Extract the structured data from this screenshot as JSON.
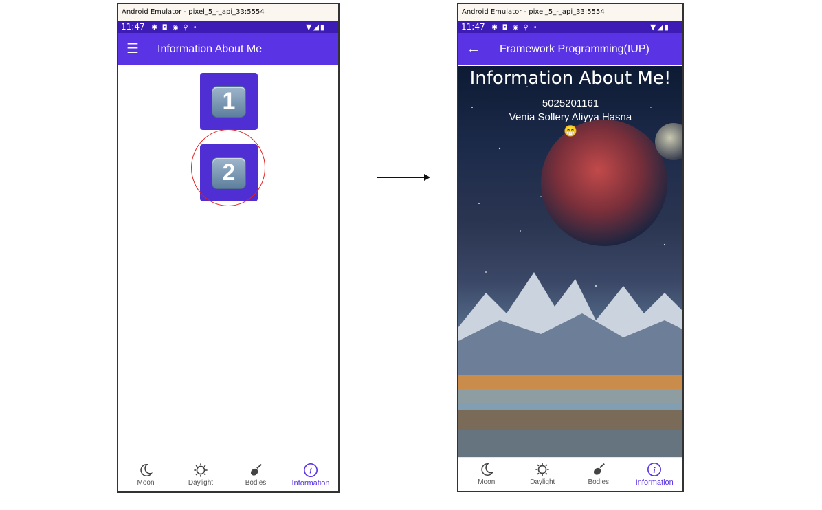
{
  "left_window": {
    "title": "Android Emulator - pixel_5_-_api_33:5554",
    "status_time": "11:47",
    "appbar_title": "Information About Me",
    "buttons": [
      "1",
      "2"
    ]
  },
  "right_window": {
    "title": "Android Emulator - pixel_5_-_api_33:5554",
    "status_time": "11:47",
    "appbar_title": "Framework Programming(IUP)",
    "heading": "Information About Me!",
    "student_id": "5025201161",
    "student_name": "Venia Sollery Aliyya Hasna",
    "emoji": "😁"
  },
  "bottom_nav": [
    "Moon",
    "Daylight",
    "Bodies",
    "Information"
  ],
  "colors": {
    "status_bar": "#3d1bb5",
    "app_bar": "#5a34e4",
    "button_bg": "#4f2fd3",
    "active_nav": "#5a34e4",
    "highlight_circle": "#e32222"
  },
  "icons": {
    "menu": "hamburger-icon",
    "back": "back-arrow-icon",
    "nav": [
      "moon-icon",
      "daylight-icon",
      "bodies-icon",
      "info-icon"
    ]
  }
}
